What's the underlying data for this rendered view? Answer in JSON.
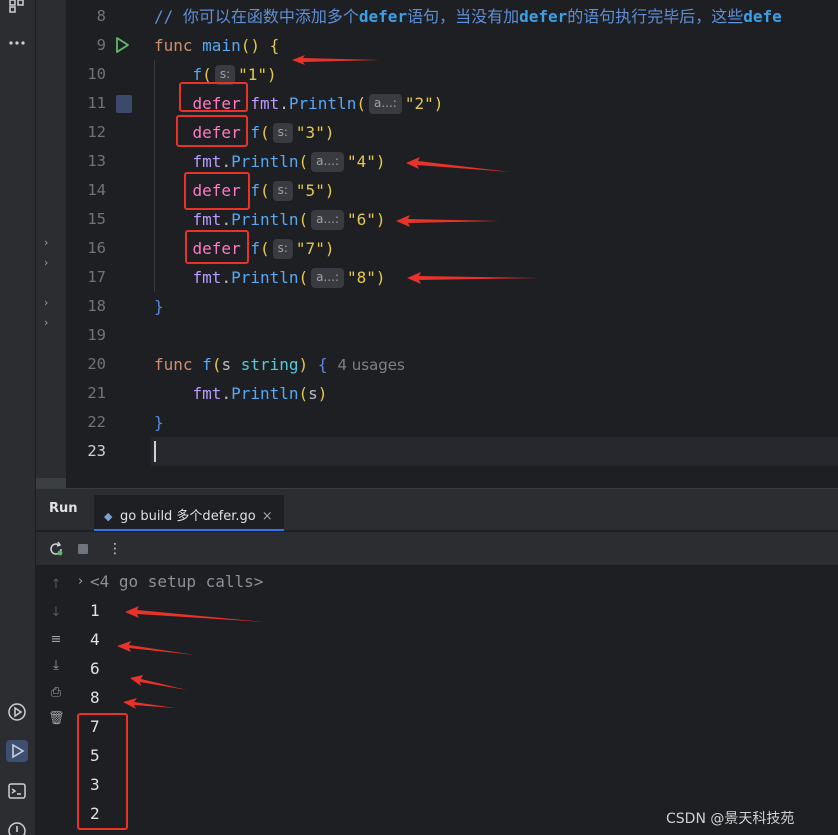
{
  "editor": {
    "line_numbers": [
      "8",
      "9",
      "10",
      "11",
      "12",
      "13",
      "14",
      "15",
      "16",
      "17",
      "18",
      "19",
      "20",
      "21",
      "22",
      "23"
    ],
    "comment_prefix": "// 你可以在函数中添加多个",
    "comment_kw1": "defer",
    "comment_mid": "语句，当没有加",
    "comment_kw2": "defer",
    "comment_end": "的语句执行完毕后，这些",
    "comment_kw3": "defe",
    "kw_func": "func",
    "main_name": "main",
    "f_name": "f",
    "defer_kw": "defer",
    "pkg_fmt": "fmt",
    "println": "Println",
    "hint_s": "s:",
    "hint_a": "a...:",
    "param_s": "s",
    "type_string": "string",
    "usages": "4 usages",
    "strings": [
      "\"1\"",
      "\"2\"",
      "\"3\"",
      "\"4\"",
      "\"5\"",
      "\"6\"",
      "\"7\"",
      "\"8\""
    ]
  },
  "run_panel": {
    "title": "Run",
    "tab_label": "go build 多个defer.go",
    "tab_close": "×",
    "setup_calls": "<4 go setup calls>",
    "output": [
      "1",
      "4",
      "6",
      "8",
      "7",
      "5",
      "3",
      "2"
    ]
  },
  "watermark": "CSDN @景天科技苑",
  "colors": {
    "annotation_red": "#e8332a",
    "accent_blue": "#3574f0"
  }
}
